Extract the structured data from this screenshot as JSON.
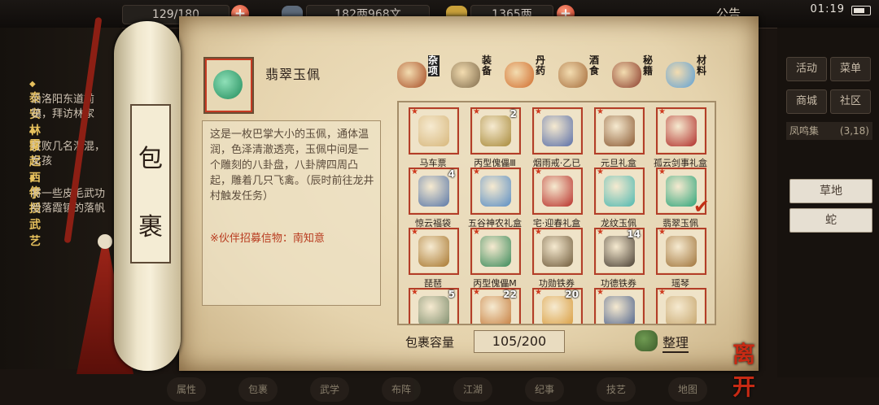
{
  "topbar": {
    "count_partial": "129/180",
    "money": "182两968文",
    "gold": "1365两",
    "announce": "公告",
    "time": "01:19"
  },
  "quests": [
    {
      "title": "泰安林家",
      "lines": [
        "沿洛阳东道前",
        "镇，拜访林家"
      ]
    },
    {
      "title": "雾起西子",
      "lines": [
        "打败几名混混，",
        "女孩"
      ]
    },
    {
      "title": "传授武艺",
      "lines": [
        "将一些皮毛武功",
        "给落霞镇的落帆"
      ]
    }
  ],
  "right_menu": {
    "buttons": [
      "活动",
      "菜单",
      "商城",
      "社区"
    ],
    "location": "凤鸣集",
    "coords": "(3,18)",
    "places": [
      "草地",
      "蛇"
    ]
  },
  "scroll_title": [
    "包",
    "裹"
  ],
  "selected_item": {
    "name": "翡翠玉佩",
    "description": "这是一枚巴掌大小的玉佩，通体温润，色泽清澈透亮，玉佩中间是一个雕刻的八卦盘，八卦牌四周凸起，雕着几只飞禽。（辰时前往龙井村触发任务）",
    "partner_note": "※伙伴招募信物：南知意"
  },
  "categories": [
    {
      "label": "杂项",
      "active": true,
      "color": "#a64b23"
    },
    {
      "label": "装备",
      "active": false,
      "color": "#7e6a4a"
    },
    {
      "label": "丹药",
      "active": false,
      "color": "#d06a2a"
    },
    {
      "label": "酒食",
      "active": false,
      "color": "#a46b3a"
    },
    {
      "label": "秘籍",
      "active": false,
      "color": "#8a3a2a"
    },
    {
      "label": "材料",
      "active": false,
      "color": "#5b9fd6"
    }
  ],
  "items": [
    {
      "name": "马车票",
      "count": "",
      "color": "#d7b77c"
    },
    {
      "name": "丙型傀儡Ⅲ",
      "count": "2",
      "color": "#a88a3a"
    },
    {
      "name": "烟雨戒·乙已",
      "count": "",
      "color": "#5a6fa8"
    },
    {
      "name": "元旦礼盒",
      "count": "",
      "color": "#8b5a33"
    },
    {
      "name": "孤云剑事礼盒",
      "count": "",
      "color": "#b02e2a"
    },
    {
      "name": "惊云福袋",
      "count": "4",
      "color": "#5a78a8"
    },
    {
      "name": "五谷神农礼盒",
      "count": "",
      "color": "#5a8ec4"
    },
    {
      "name": "宅·迎春礼盒",
      "count": "",
      "color": "#b8302a"
    },
    {
      "name": "龙纹玉佩",
      "count": "",
      "color": "#4fb8b0"
    },
    {
      "name": "翡翠玉佩",
      "count": "",
      "color": "#2fa57a",
      "selected": true
    },
    {
      "name": "琵琶",
      "count": "",
      "color": "#a8772f"
    },
    {
      "name": "丙型傀儡M",
      "count": "",
      "color": "#3a8a5a"
    },
    {
      "name": "功勋铁券",
      "count": "",
      "color": "#6f5a3a"
    },
    {
      "name": "功德铁券",
      "count": "14",
      "color": "#4a3f33"
    },
    {
      "name": "瑶琴",
      "count": "",
      "color": "#a0743a"
    },
    {
      "name": "",
      "count": "5",
      "color": "#7a8a6a"
    },
    {
      "name": "",
      "count": "22",
      "color": "#c47a3a"
    },
    {
      "name": "",
      "count": "20",
      "color": "#d89a3a"
    },
    {
      "name": "",
      "count": "",
      "color": "#4a5f8a"
    },
    {
      "name": "",
      "count": "",
      "color": "#c4a36a"
    }
  ],
  "capacity": {
    "label": "包裹容量",
    "value": "105/200"
  },
  "sort_label": "整理",
  "close_label": "离开",
  "bottom_bar": [
    "属性",
    "包裹",
    "武学",
    "布阵",
    "江湖",
    "纪事",
    "技艺",
    "地图"
  ]
}
